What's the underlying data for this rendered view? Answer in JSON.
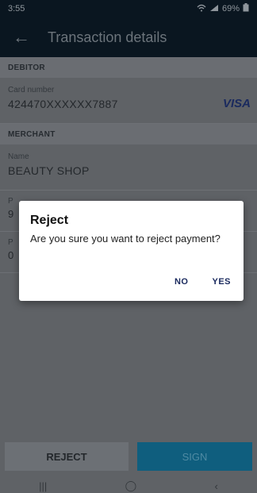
{
  "status_bar": {
    "time": "3:55",
    "battery": "69%"
  },
  "app_bar": {
    "title": "Transaction details",
    "back_icon": "arrow-left-icon"
  },
  "debitor": {
    "section_title": "DEBITOR",
    "card_label": "Card number",
    "card_value": "424470XXXXXX7887",
    "brand": "VISA"
  },
  "merchant": {
    "section_title": "MERCHANT",
    "name_label": "Name",
    "name_value": "BEAUTY SHOP"
  },
  "partials": [
    {
      "label": "P",
      "value": "9"
    },
    {
      "label": "P",
      "value": "0"
    }
  ],
  "dialog": {
    "title": "Reject",
    "message": "Are you sure you want to reject payment?",
    "no": "NO",
    "yes": "YES"
  },
  "buttons": {
    "reject": "REJECT",
    "sign": "SIGN"
  },
  "nav": {
    "recents": "|||",
    "home": "◯",
    "back": "‹"
  }
}
